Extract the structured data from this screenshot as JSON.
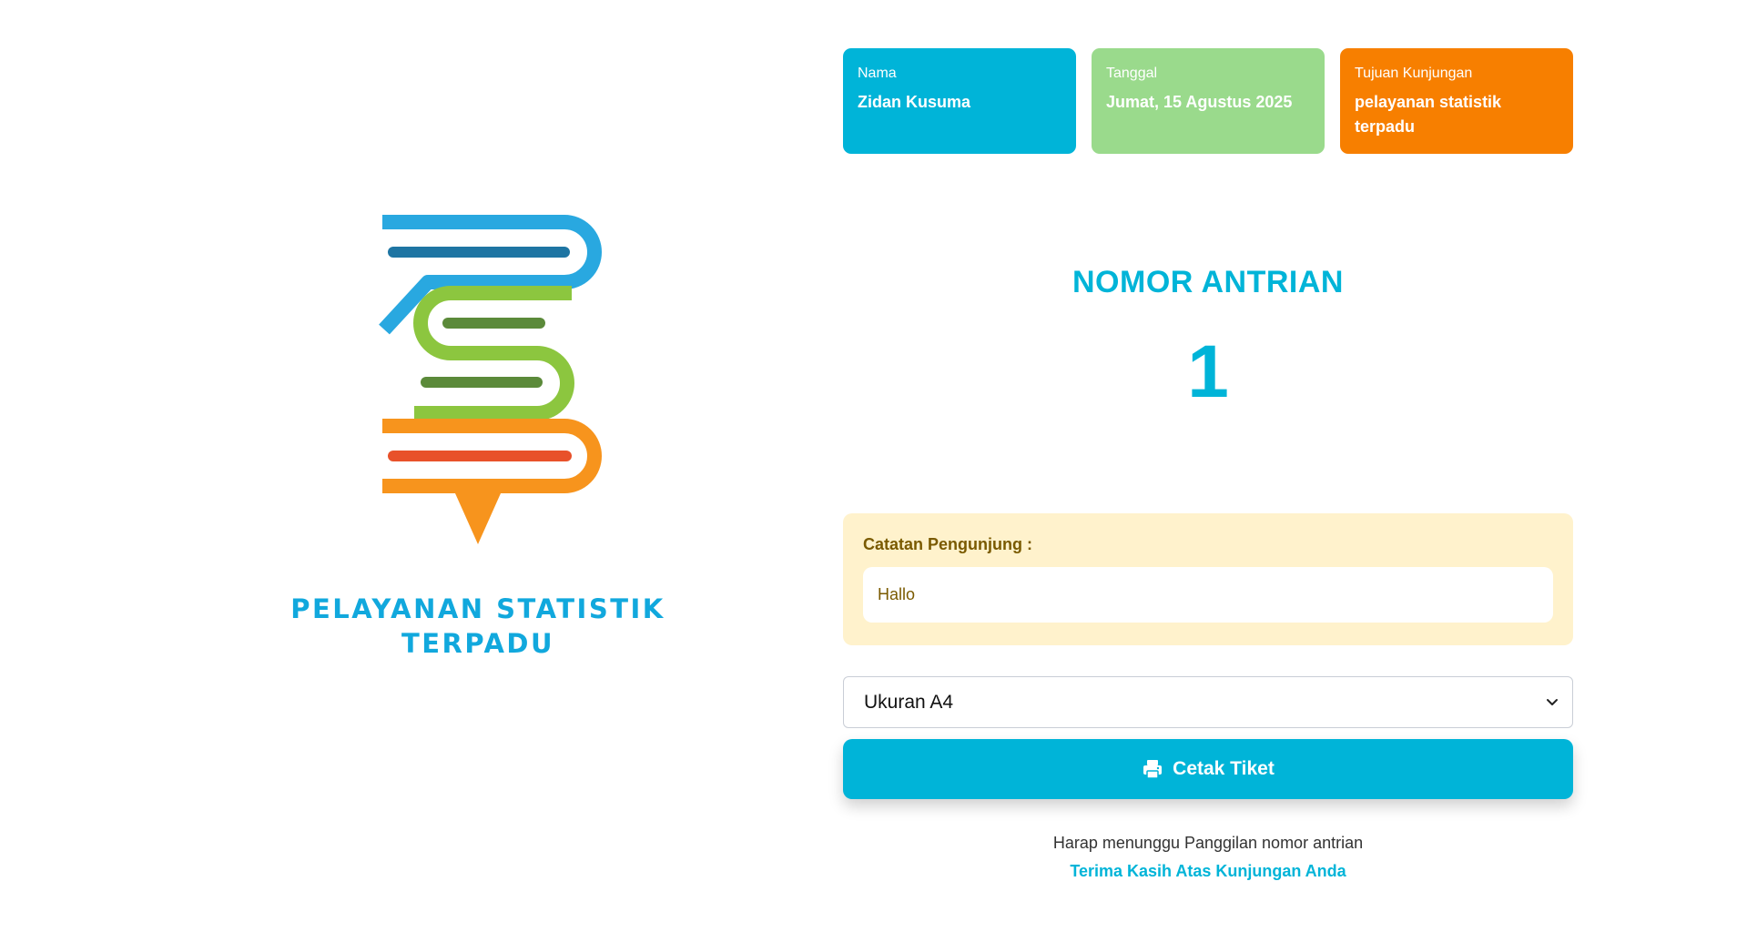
{
  "logo": {
    "line1": "PELAYANAN STATISTIK",
    "line2": "TERPADU",
    "colors": {
      "blue": "#29a8e0",
      "blue_dark": "#1e75a3",
      "green": "#8cc63f",
      "green_dark": "#5b8a3a",
      "orange": "#f7941d",
      "red": "#e8512a"
    }
  },
  "cards": {
    "name": {
      "label": "Nama",
      "value": "Zidan Kusuma",
      "color": "#00b4d8"
    },
    "date": {
      "label": "Tanggal",
      "value": "Jumat, 15 Agustus 2025",
      "color": "#9ada8c"
    },
    "purpose": {
      "label": "Tujuan Kunjungan",
      "value": "pelayanan statistik terpadu",
      "color": "#f77f00"
    }
  },
  "queue": {
    "title": "NOMOR ANTRIAN",
    "number": "1"
  },
  "notes": {
    "label": "Catatan Pengunjung :",
    "value": "Hallo"
  },
  "print": {
    "size_selected": "Ukuran A4",
    "button_label": "Cetak Tiket",
    "button_icon": "printer-icon"
  },
  "footer": {
    "line1": "Harap menunggu Panggilan nomor antrian",
    "line2": "Terima Kasih Atas Kunjungan Anda"
  }
}
